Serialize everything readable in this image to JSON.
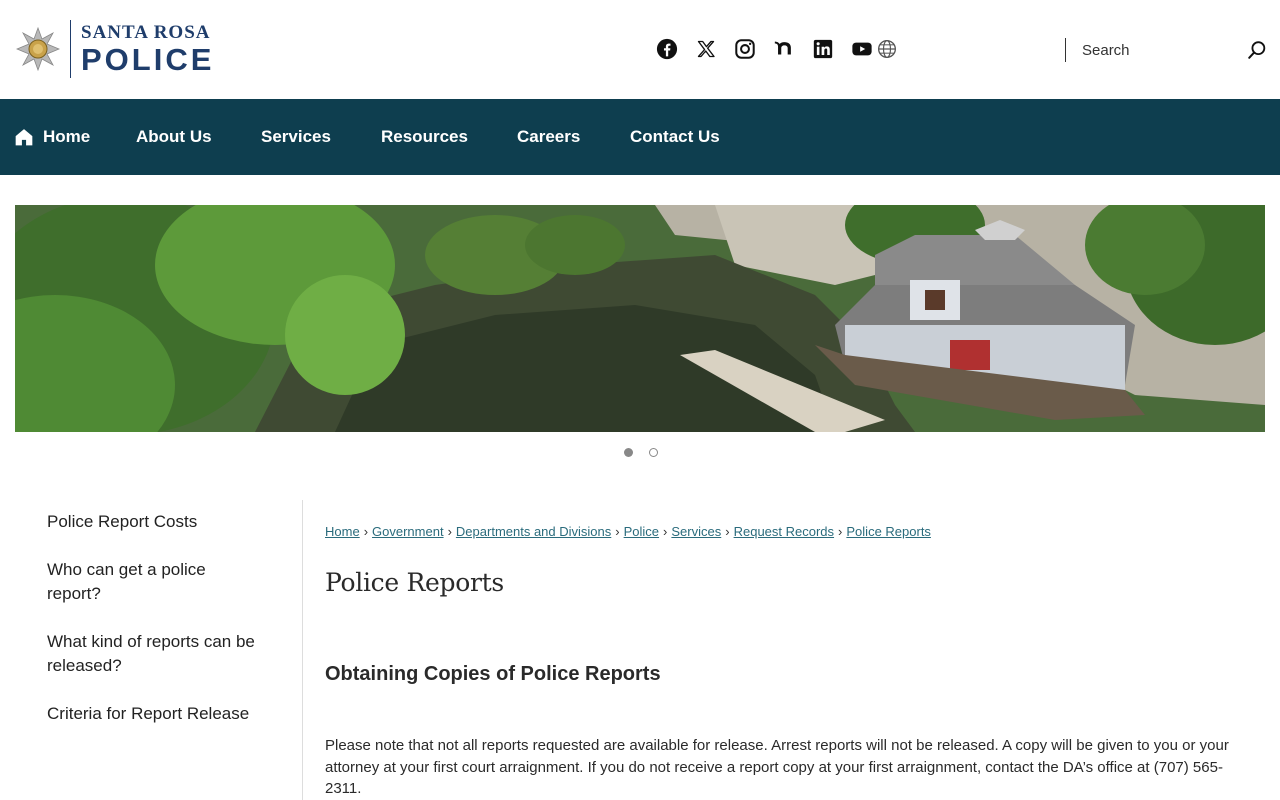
{
  "logo": {
    "line1": "SANTA ROSA",
    "line2": "POLICE",
    "color": "#1f3d6b"
  },
  "social": [
    {
      "icon": "facebook-icon"
    },
    {
      "icon": "x-twitter-icon"
    },
    {
      "icon": "instagram-icon"
    },
    {
      "icon": "nextdoor-icon"
    },
    {
      "icon": "linkedin-icon"
    },
    {
      "icon": "youtube-icon"
    },
    {
      "icon": "globe-icon"
    }
  ],
  "search": {
    "placeholder": "Search",
    "icon": "search-icon"
  },
  "nav": {
    "background": "#0e3e4f",
    "items": [
      {
        "label": "Home",
        "icon": "home-icon"
      },
      {
        "label": "About Us"
      },
      {
        "label": "Services"
      },
      {
        "label": "Resources"
      },
      {
        "label": "Careers"
      },
      {
        "label": "Contact Us"
      }
    ]
  },
  "carousel": {
    "slide_count": 2,
    "active_index": 0
  },
  "sidebar": {
    "links": [
      {
        "label": "Police Report Costs"
      },
      {
        "label": "Who can get a police report?"
      },
      {
        "label": "What kind of reports can be released?"
      },
      {
        "label": "Criteria for Report Release"
      }
    ]
  },
  "breadcrumb": [
    {
      "label": "Home"
    },
    {
      "label": "Government"
    },
    {
      "label": "Departments and Divisions"
    },
    {
      "label": "Police"
    },
    {
      "label": "Services"
    },
    {
      "label": "Request Records"
    },
    {
      "label": "Police Reports"
    }
  ],
  "page": {
    "title": "Police Reports",
    "section_title": "Obtaining Copies of Police Reports",
    "paragraph": "Please note that not all reports requested are available for release. Arrest reports will not be released. A copy will be given to you or your attorney at your first court arraignment. If you do not receive a report copy at your first arraignment, contact the DA’s office at (707) 565-2311."
  }
}
